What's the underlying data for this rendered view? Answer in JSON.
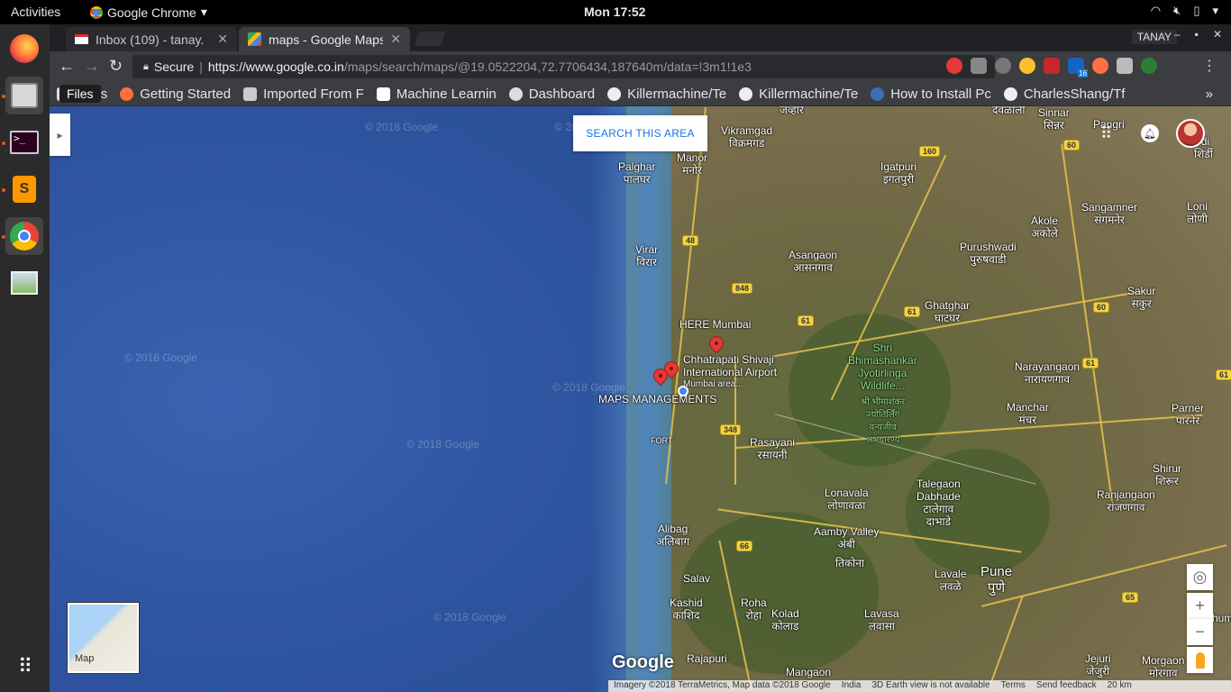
{
  "topbar": {
    "activities": "Activities",
    "app_name": "Google Chrome",
    "clock": "Mon 17:52"
  },
  "tabs": [
    {
      "label": "Inbox (109) - tanay.",
      "icon": "gmail-icon"
    },
    {
      "label": "maps - Google Maps",
      "icon": "maps-icon"
    }
  ],
  "window": {
    "profile": "TANAY"
  },
  "omnibox": {
    "secure_label": "Secure",
    "url_host": "https://www.google.co.in",
    "url_path": "/maps/search/maps/@19.0522204,72.7706434,187640m/data=!3m1!1e3"
  },
  "extension_badge": "16",
  "tooltip": "Files",
  "bookmarks": [
    {
      "label": "Apps",
      "icon": "apps-grid-icon"
    },
    {
      "label": "Getting Started",
      "icon": "firefox-icon"
    },
    {
      "label": "Imported From F",
      "icon": "folder-icon"
    },
    {
      "label": "Machine Learnin",
      "icon": "medium-icon"
    },
    {
      "label": "Dashboard",
      "icon": "dashboard-icon"
    },
    {
      "label": "Killermachine/Te",
      "icon": "github-icon"
    },
    {
      "label": "Killermachine/Te",
      "icon": "github-icon"
    },
    {
      "label": "How to Install Pc",
      "icon": "fedora-icon"
    },
    {
      "label": "CharlesShang/Tf",
      "icon": "github-icon"
    }
  ],
  "map": {
    "search_area": "SEARCH THIS AREA",
    "watermark": "© 2018 Google",
    "minimap_label": "Map",
    "logo": "Google",
    "labels": {
      "vikramgad": "Vikramgad",
      "vikramgad_mr": "विक्रमगड",
      "jawhar_mr": "जव्हार",
      "manor": "Manor",
      "manor_mr": "मनोर",
      "palghar": "Palghar",
      "palghar_mr": "पालघर",
      "virar": "Virar",
      "virar_mr": "विरार",
      "igatpuri": "Igatpuri",
      "igatpuri_mr": "इगतपुरी",
      "sinnar": "Sinnar",
      "sinnar_mr": "सिन्नर",
      "devlali_mr": "देवळाली",
      "pangri": "Pangri",
      "shirdi_r": "rdi",
      "shirdi_mr": "शिर्डी",
      "sangamner": "Sangamner",
      "sangamner_mr": "संगमनेर",
      "akole": "Akole",
      "akole_mr": "अकोले",
      "loni": "Loni",
      "loni_mr": "लोणी",
      "purushwadi": "Purushwadi",
      "purushwadi_mr": "पुरुषवाडी",
      "asangaon": "Asangaon",
      "asangaon_mr": "आसनगाव",
      "ghatghar": "Ghatghar",
      "ghatghar_mr": "घाटघर",
      "sakur": "Sakur",
      "sakur_mr": "सकुर",
      "here_mumbai": "HERE Mumbai",
      "airport1": "Chhatrapati Shivaji",
      "airport2": "International Airport",
      "mumbai_area": "Mumbai area...",
      "maps_mgmt": "MAPS MANAGEMENTS",
      "shri": "Shri",
      "bhimashankar": "Bhimashankar",
      "jyotirlinga": "Jyotirlinga",
      "wildlife": "Wildlife...",
      "bhim_mr1": "श्री भीमाशंकर",
      "bhim_mr2": "ज्योतिर्लिंग",
      "bhim_mr3": "वन्यजीव",
      "bhim_mr4": "अभयारण्य",
      "narayangaon": "Narayangaon",
      "narayangaon_mr": "नारायणगाव",
      "manchar": "Manchar",
      "manchar_mr": "मंचर",
      "parner": "Parner",
      "parner_mr": "पारनेर",
      "fort": "FORT",
      "rasayani": "Rasayani",
      "rasayani_mr": "रसायनी",
      "shirur": "Shirur",
      "shirur_mr": "शिरूर",
      "talegaon1": "Talegaon",
      "talegaon2": "Dabhade",
      "talegaon_mr1": "टालेगाव",
      "talegaon_mr2": "दाभाडे",
      "lonavala": "Lonavala",
      "lonavala_mr": "लोणावळा",
      "ranjangaon": "Ranjangaon",
      "ranjangaon_mr": "रांजणगाव",
      "alibag": "Alibag",
      "alibag_mr": "अलिबाग",
      "amby_valley": "Aamby Valley",
      "amby_mr": "अंबी",
      "lavale": "Lavale",
      "lavale_mr": "लवळे",
      "pune": "Pune",
      "pune_mr": "पुणे",
      "salav": "Salav",
      "tikona_mr": "तिकोना",
      "kashid": "Kashid",
      "kashid_mr": "काशिद",
      "roha": "Roha",
      "roha_mr": "रोहा",
      "kolad": "Kolad",
      "kolad_mr": "कोलाड",
      "lavasa": "Lavasa",
      "lavasa_mr": "लवासा",
      "jejuri": "Jejuri",
      "jejuri_mr": "जेजुरी",
      "morgaon": "Morgaon",
      "morgaon_mr": "मोरगाव",
      "rajapuri": "Rajapuri",
      "mangaon": "Mangaon",
      "jhumb": "humb"
    },
    "shields": [
      "160",
      "60",
      "48",
      "848",
      "61",
      "61",
      "60",
      "61",
      "61",
      "348",
      "66",
      "65"
    ],
    "footer": {
      "imagery": "Imagery ©2018 TerraMetrics, Map data ©2018 Google",
      "india": "India",
      "earth": "3D Earth view is not available",
      "terms": "Terms",
      "feedback": "Send feedback",
      "scale": "20 km"
    }
  }
}
